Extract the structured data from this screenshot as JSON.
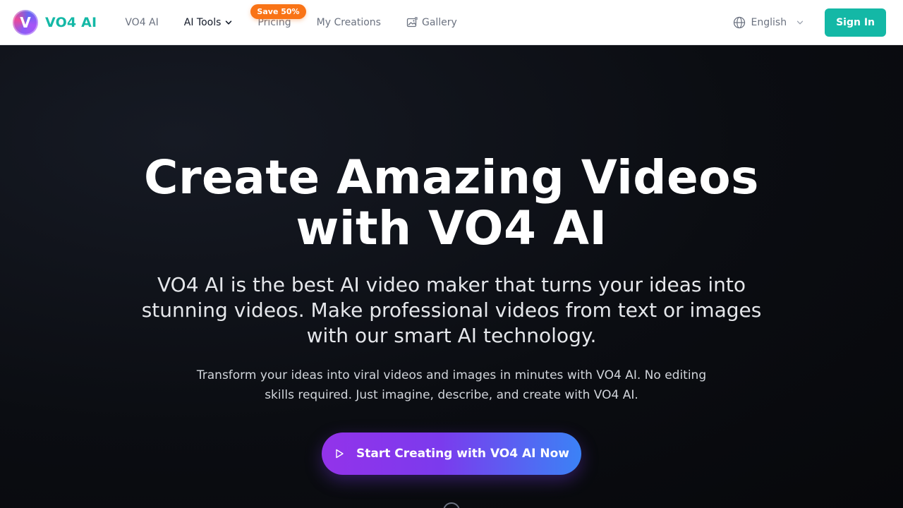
{
  "brand": {
    "logo_letter": "V",
    "name": "VO4 AI"
  },
  "nav": {
    "home": "VO4 AI",
    "ai_tools": "AI Tools",
    "pricing": "Pricing",
    "pricing_badge": "Save 50%",
    "my_creations": "My Creations",
    "gallery": "Gallery"
  },
  "header_right": {
    "language": "English",
    "sign_in": "Sign In"
  },
  "hero": {
    "title_line1": "Create Amazing Videos",
    "title_line2": "with VO4 AI",
    "lead": "VO4 AI is the best AI video maker that turns your ideas into stunning videos. Make professional videos from text or images with our smart AI technology.",
    "sub": "Transform your ideas into viral videos and images in minutes with VO4 AI. No editing skills required. Just imagine, describe, and create with VO4 AI.",
    "cta": "Start Creating with VO4 AI Now"
  },
  "colors": {
    "brand": "#14b8a6",
    "badge": "#f97316",
    "cta_start": "#9333ea",
    "cta_end": "#3b82f6",
    "hero_bg": "#0b0d12"
  },
  "icons": {
    "language": "globe-icon",
    "gallery": "gallery-icon",
    "dropdown": "chevron-down-icon",
    "cta": "play-icon"
  }
}
